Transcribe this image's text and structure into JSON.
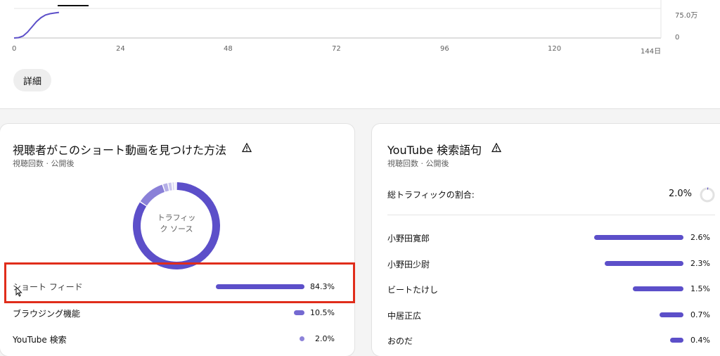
{
  "chart_data": {
    "type": "line",
    "xlabel": "",
    "ylabel": "",
    "x_ticks": [
      "0",
      "24",
      "48",
      "72",
      "96",
      "120",
      "144日"
    ],
    "y_ticks": [
      "0",
      "75.0万"
    ],
    "xlim": [
      0,
      144
    ],
    "ylim": [
      0,
      75
    ],
    "x": [
      0,
      1,
      2,
      3,
      4,
      5,
      6,
      7,
      8,
      9,
      10
    ],
    "y": [
      0,
      1,
      6,
      18,
      34,
      50,
      62,
      70,
      74,
      76,
      78
    ]
  },
  "top": {
    "details_button": "詳細"
  },
  "traffic_sources": {
    "title": "視聴者がこのショート動画を見つけた方法",
    "subtitle": "視聴回数 · 公開後",
    "donut_center": [
      "トラフィッ",
      "ク ソース"
    ],
    "rows": [
      {
        "label": "ショート フィード",
        "value": "84.3%"
      },
      {
        "label": "ブラウジング機能",
        "value": "10.5%"
      },
      {
        "label": "YouTube 検索",
        "value": "2.0%"
      }
    ],
    "shares": [
      84.3,
      10.5,
      2.0,
      1.5,
      1.0,
      0.7
    ]
  },
  "search_terms": {
    "title": "YouTube 検索語句",
    "subtitle": "視聴回数 · 公開後",
    "total_label": "総トラフィックの割合:",
    "total_value": "2.0%",
    "rows": [
      {
        "label": "小野田寛郎",
        "value": "2.6%"
      },
      {
        "label": "小野田少尉",
        "value": "2.3%"
      },
      {
        "label": "ビートたけし",
        "value": "1.5%"
      },
      {
        "label": "中居正広",
        "value": "0.7%"
      },
      {
        "label": "おのだ",
        "value": "0.4%"
      }
    ]
  },
  "colors": {
    "accent": "#5c4fc9",
    "highlight": "#e02d1b"
  }
}
